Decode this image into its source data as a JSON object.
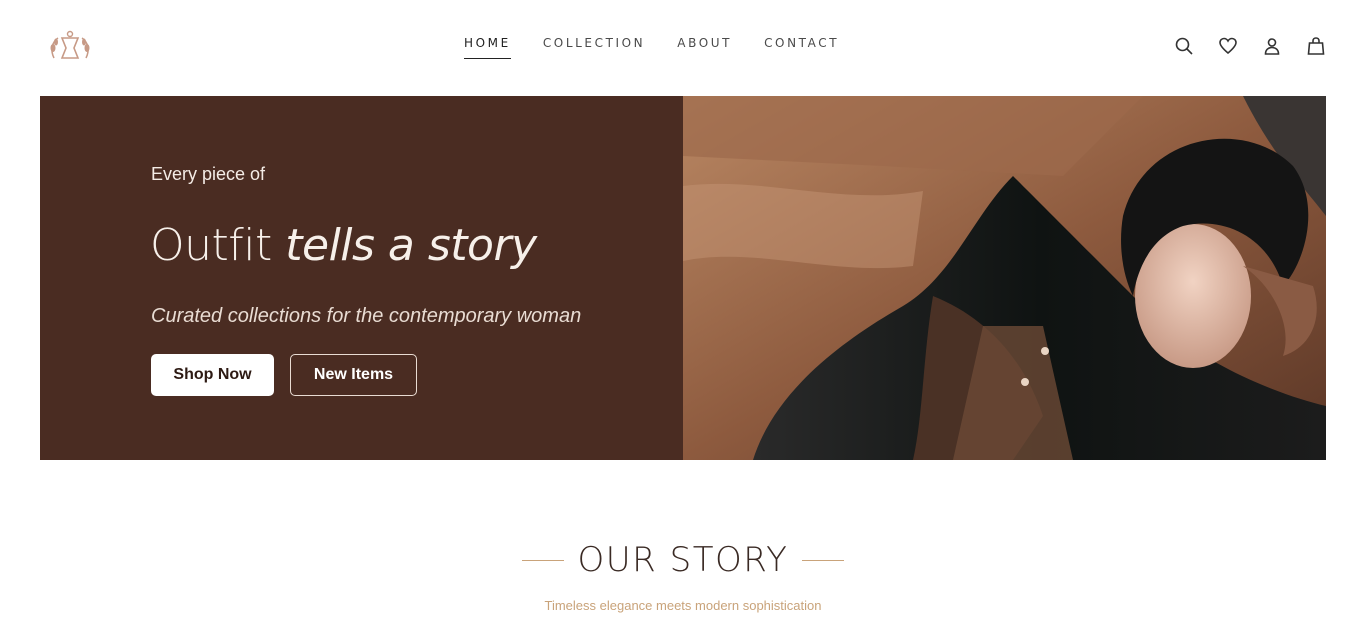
{
  "nav": {
    "items": [
      {
        "label": "HOME",
        "active": true
      },
      {
        "label": "COLLECTION",
        "active": false
      },
      {
        "label": "ABOUT",
        "active": false
      },
      {
        "label": "CONTACT",
        "active": false
      }
    ]
  },
  "header": {
    "icons": [
      "search-icon",
      "heart-icon",
      "user-icon",
      "bag-icon"
    ]
  },
  "hero": {
    "small_text": "Every piece of",
    "title_main": "Outfit",
    "title_italic": "tells a story",
    "subtitle": "Curated collections for the contemporary woman",
    "primary_button": "Shop Now",
    "secondary_button": "New Items"
  },
  "story": {
    "title": "OUR STORY",
    "subtitle": "Timeless elegance meets modern sophistication"
  },
  "colors": {
    "hero_bg": "#4a2c22",
    "accent_gold": "#c9a37a",
    "text_dark": "#3a2a24"
  }
}
